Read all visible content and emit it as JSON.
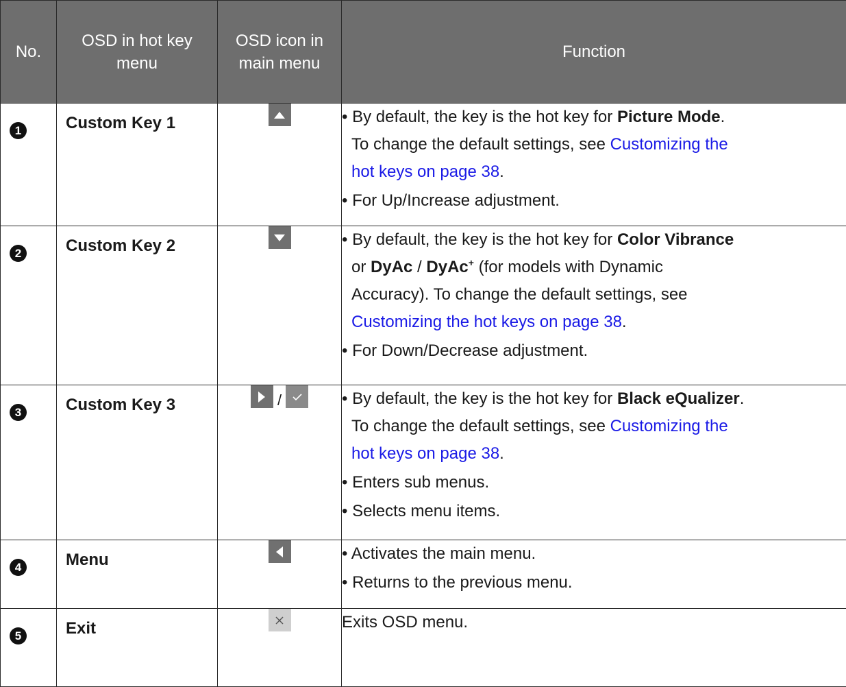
{
  "header": {
    "no": "No.",
    "osd_hotkey": "OSD in hot key menu",
    "osd_icon": "OSD icon in main menu",
    "function": "Function"
  },
  "rows": [
    {
      "num": "1",
      "key": "Custom Key 1",
      "icon": "triangle-up-icon",
      "f1a": "• By default, the key is the hot key for ",
      "f1b": "Picture Mode",
      "f1c": ".",
      "f1d": "To change the default settings, see ",
      "f1link1": "Customizing the",
      "f1link2": "hot keys on page 38",
      "f1e": ".",
      "f2": "• For Up/Increase adjustment."
    },
    {
      "num": "2",
      "key": "Custom Key 2",
      "icon": "triangle-down-icon",
      "f1a": "• By default, the key is the hot key for ",
      "f1b": "Color Vibrance",
      "f1c": "or ",
      "f1d": "DyAc",
      "f1e": " / ",
      "f1f": "DyAc",
      "f1sup": "+",
      "f1g": " (for models with Dynamic",
      "f1h": "Accuracy). To change the default settings, see",
      "f1link": "Customizing the hot keys on page 38",
      "f1i": ".",
      "f2": "• For Down/Decrease adjustment."
    },
    {
      "num": "3",
      "key": "Custom Key 3",
      "icon_a": "triangle-right-icon",
      "separator": "/",
      "icon_b": "checkmark-icon",
      "f1a": "• By default, the key is the hot key for ",
      "f1b": "Black eQualizer",
      "f1c": ".",
      "f1d": "To change the default settings, see ",
      "f1link1": "Customizing the",
      "f1link2": "hot keys on page 38",
      "f1e": ".",
      "f2": "• Enters sub menus.",
      "f3": "• Selects menu items."
    },
    {
      "num": "4",
      "key": "Menu",
      "icon": "triangle-left-icon",
      "f1": "• Activates the main menu.",
      "f2": "• Returns to the previous menu."
    },
    {
      "num": "5",
      "key": "Exit",
      "icon": "close-x-icon",
      "f1": "Exits OSD menu."
    }
  ],
  "colors": {
    "header_bg": "#6e6e6e",
    "link": "#1a1ae6",
    "icon_bg": "#707070"
  }
}
